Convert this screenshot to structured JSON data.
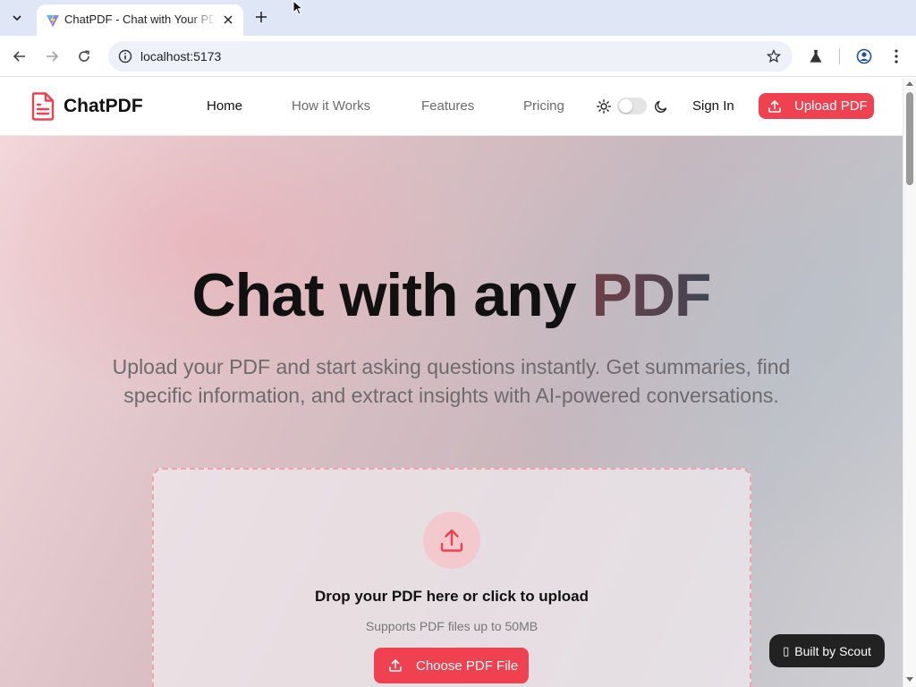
{
  "browser": {
    "tab_title": "ChatPDF - Chat with Your PDF",
    "url": "localhost:5173",
    "icons": {
      "tab_dropdown": "chevron-down-icon",
      "close": "close-icon",
      "new_tab": "plus-icon",
      "back": "arrow-left-icon",
      "forward": "arrow-right-icon",
      "reload": "reload-icon",
      "site_info": "info-icon",
      "bookmark": "star-icon",
      "labs": "flask-icon",
      "profile": "profile-icon",
      "menu": "kebab-menu-icon"
    }
  },
  "header": {
    "logo_text": "ChatPDF",
    "nav": [
      {
        "label": "Home",
        "active": true
      },
      {
        "label": "How it Works",
        "active": false
      },
      {
        "label": "Features",
        "active": false
      },
      {
        "label": "Pricing",
        "active": false
      }
    ],
    "theme_toggle_on": false,
    "sign_in": "Sign In",
    "upload_button": "Upload PDF"
  },
  "hero": {
    "title_plain": "Chat with any ",
    "title_highlight": "PDF",
    "subtitle": "Upload your PDF and start asking questions instantly. Get summaries, find specific information, and extract insights with AI-powered conversations."
  },
  "dropzone": {
    "title": "Drop your PDF here or click to upload",
    "subtitle": "Supports PDF files up to 50MB",
    "button": "Choose PDF File"
  },
  "badge": {
    "label": "Built by Scout"
  },
  "colors": {
    "accent": "#ef4150",
    "accent_light": "#f3c9ce",
    "dashed_border": "#efa3ab",
    "text_primary": "#111111",
    "text_muted": "#6e6a6e",
    "badge_bg": "#222222"
  }
}
